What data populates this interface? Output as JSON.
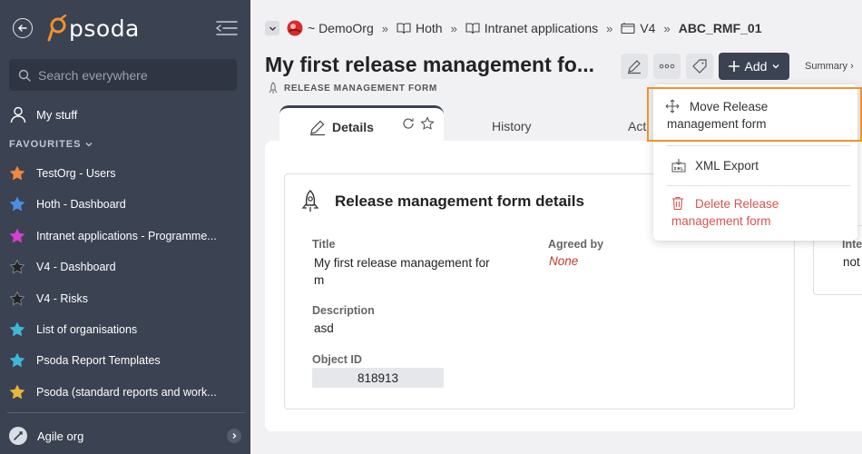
{
  "sidebar": {
    "logo_text": "psoda",
    "search_placeholder": "Search everywhere",
    "my_stuff": "My stuff",
    "favourites_header": "FAVOURITES",
    "favourites": [
      {
        "label": "TestOrg - Users",
        "color": "#f0883e"
      },
      {
        "label": "Hoth - Dashboard",
        "color": "#4a90e2"
      },
      {
        "label": "Intranet applications - Programme...",
        "color": "#d43fd4"
      },
      {
        "label": "V4 - Dashboard",
        "color": "#222222"
      },
      {
        "label": "V4 - Risks",
        "color": "#222222"
      },
      {
        "label": "List of organisations",
        "color": "#3fb7d9"
      },
      {
        "label": "Psoda Report Templates",
        "color": "#3fb7d9"
      },
      {
        "label": "Psoda (standard reports and work...",
        "color": "#e8b63a"
      }
    ],
    "org": "Agile org"
  },
  "breadcrumb": {
    "org": "~ DemoOrg",
    "items": [
      "Hoth",
      "Intranet applications",
      "V4"
    ],
    "current": "ABC_RMF_01",
    "separator": "»"
  },
  "header": {
    "title": "My first release management fo...",
    "subtitle": "RELEASE MANAGEMENT FORM",
    "add_label": "Add",
    "summary_label": "Summary ›"
  },
  "tabs": {
    "details": "Details",
    "history": "History",
    "actions": "Acti"
  },
  "details_card": {
    "title": "Release management form details",
    "title_label": "Title",
    "title_value_l1": "My first release management for",
    "title_value_l2": "m",
    "agreed_label": "Agreed by",
    "agreed_value": "None",
    "description_label": "Description",
    "description_value": "asd",
    "object_id_label": "Object ID",
    "object_id_value": "818913"
  },
  "side_card": {
    "label": "Inte",
    "value": "not"
  },
  "dropdown": {
    "move_l1": "Move Release",
    "move_l2": "management form",
    "xml_export": "XML Export",
    "delete_l1": "Delete Release",
    "delete_l2": "management form"
  },
  "colors": {
    "sidebar_bg": "#3b4252",
    "accent": "#3b4252",
    "highlight": "#f0922b",
    "danger": "#d9534f"
  }
}
